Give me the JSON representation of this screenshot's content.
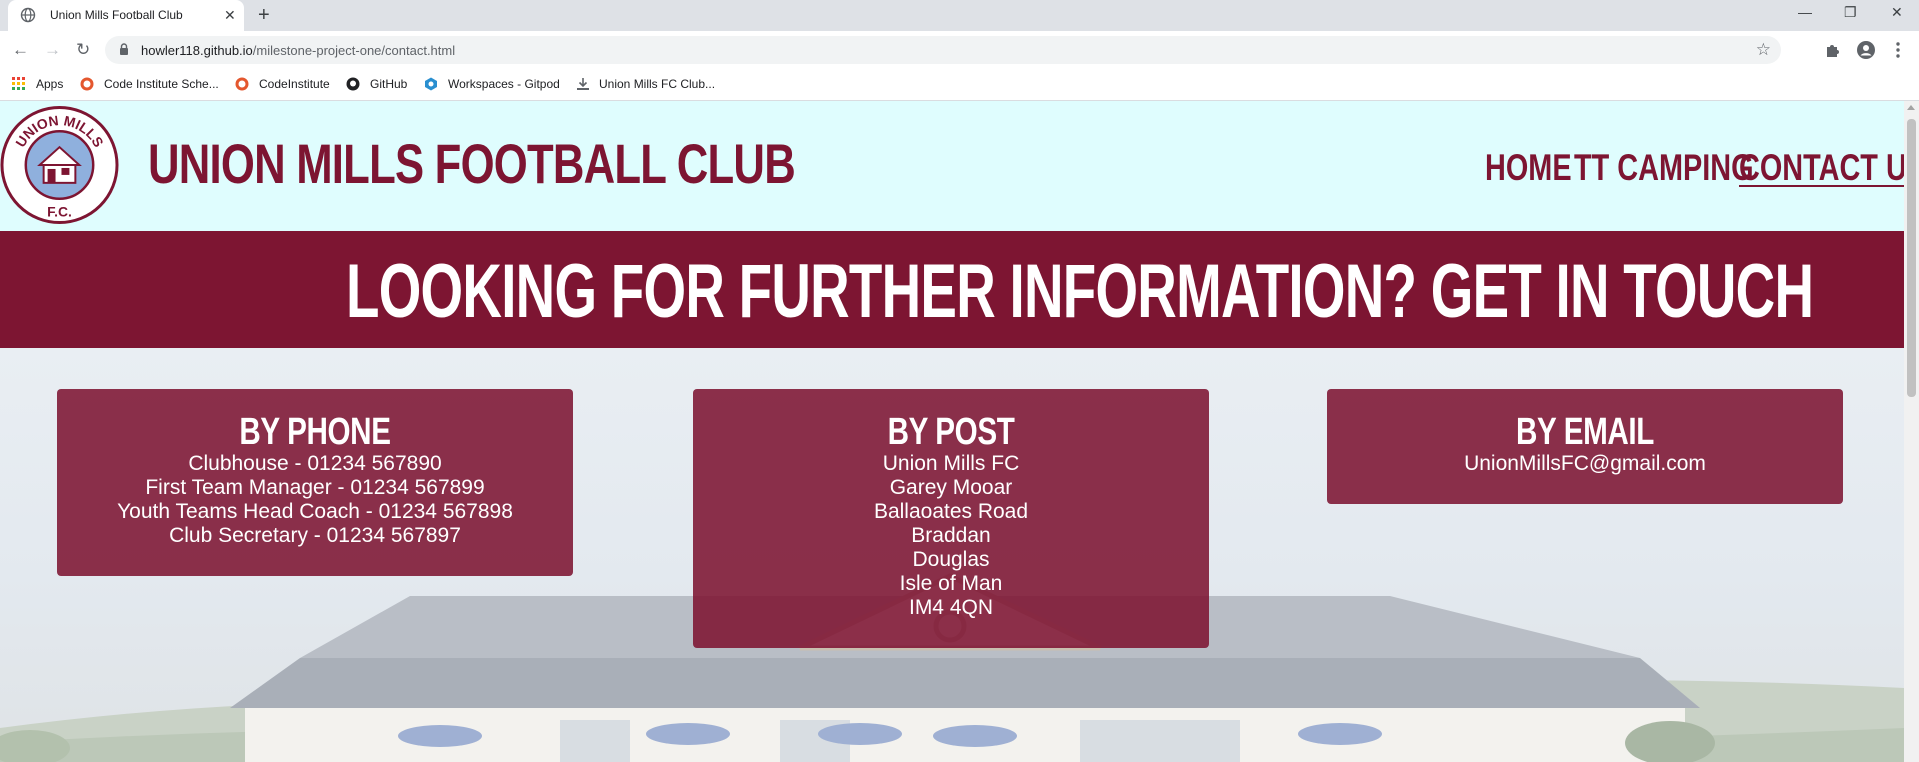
{
  "browser": {
    "tab_title": "Union Mills Football Club",
    "url_host": "howler118.github.io",
    "url_path": "/milestone-project-one/contact.html",
    "bookmarks": [
      {
        "label": "Apps",
        "icon": "apps-grid-icon"
      },
      {
        "label": "Code Institute Sche...",
        "icon": "code-institute-icon"
      },
      {
        "label": "CodeInstitute",
        "icon": "code-institute-icon"
      },
      {
        "label": "GitHub",
        "icon": "github-icon"
      },
      {
        "label": "Workspaces - Gitpod",
        "icon": "gitpod-icon"
      },
      {
        "label": "Union Mills FC Club...",
        "icon": "download-icon"
      }
    ]
  },
  "site": {
    "title": "UNION MILLS FOOTBALL CLUB",
    "logo_text": {
      "top": "UNION MILLS",
      "bottom": "F.C."
    },
    "nav": [
      {
        "label": "HOME",
        "active": false
      },
      {
        "label": "TT CAMPING",
        "active": false
      },
      {
        "label": "CONTACT US",
        "active": true
      }
    ],
    "banner": "LOOKING FOR FURTHER INFORMATION? GET IN TOUCH",
    "cards": [
      {
        "heading": "BY PHONE",
        "lines": [
          "Clubhouse - 01234 567890",
          "First Team Manager - 01234 567899",
          "Youth Teams Head Coach - 01234 567898",
          "Club Secretary - 01234 567897"
        ]
      },
      {
        "heading": "BY POST",
        "lines": [
          "Union Mills FC",
          "Garey Mooar",
          "Ballaoates Road",
          "Braddan",
          "Douglas",
          "Isle of Man",
          "IM4 4QN"
        ]
      },
      {
        "heading": "BY EMAIL",
        "lines": [
          "UnionMillsFC@gmail.com"
        ]
      }
    ]
  },
  "colors": {
    "brand": "#7d1532",
    "header_bg": "#dffdfe"
  }
}
